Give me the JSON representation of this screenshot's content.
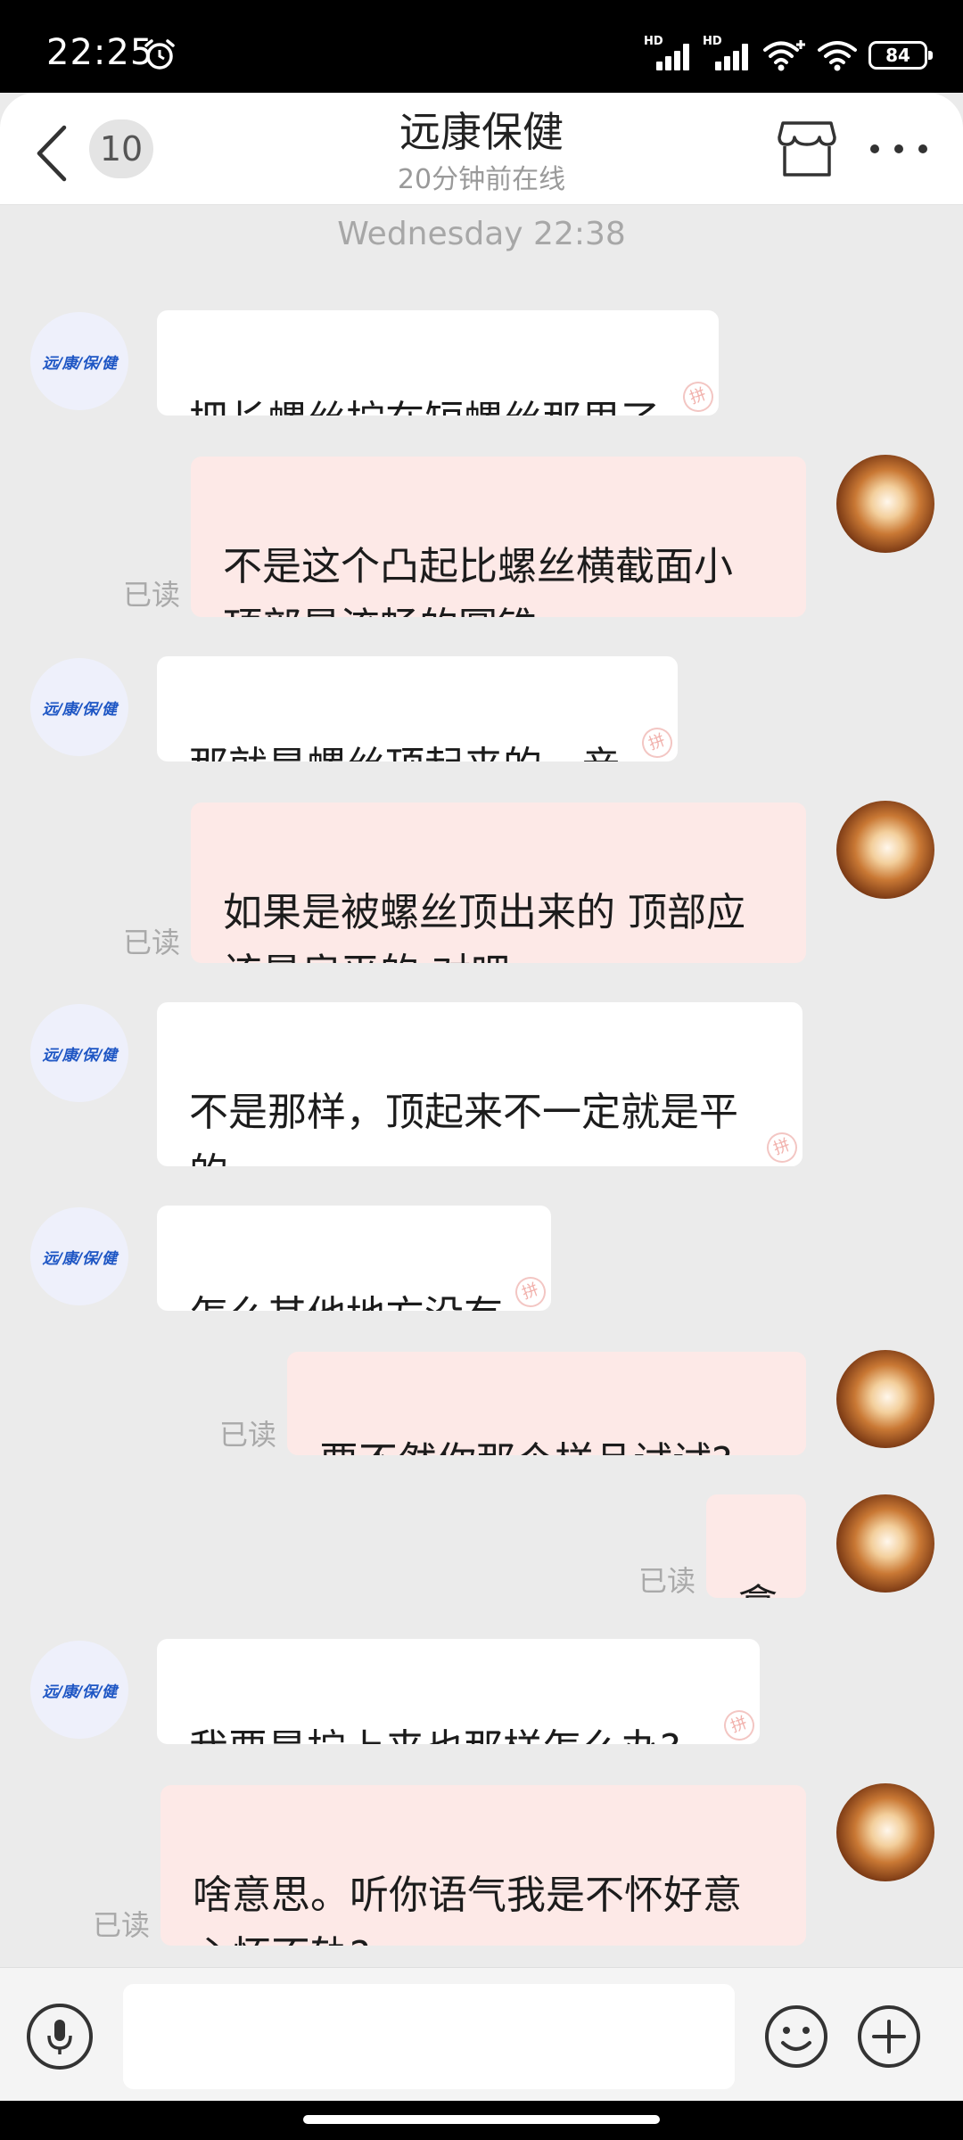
{
  "status_bar": {
    "time": "22:25",
    "signal_label_1": "HD",
    "signal_label_2": "HD",
    "battery": "84",
    "icons": [
      "alarm-icon",
      "signal-icon",
      "signal-icon",
      "wifi-icon",
      "wifi-icon",
      "battery-icon"
    ]
  },
  "header": {
    "title": "远康保健",
    "subtitle": "20分钟前在线",
    "unread_count": "10",
    "icons": [
      "back-icon",
      "shop-icon",
      "more-icon"
    ]
  },
  "conversation": {
    "time_divider": "Wednesday 22:38",
    "shop_avatar_text": "远/康/保/健",
    "messages": [
      {
        "side": "in",
        "text": "把长螺丝拧在短螺丝那里了"
      },
      {
        "side": "out",
        "text": "不是这个凸起比螺丝横截面小\n顶部是流畅的圆锥",
        "status": "已读"
      },
      {
        "side": "in",
        "text": "那就是螺丝顶起来的，亲"
      },
      {
        "side": "out",
        "text": "如果是被螺丝顶出来的 顶部应\n该是扁平的 对吧",
        "status": "已读"
      },
      {
        "side": "in",
        "text": "不是那样，顶起来不一定就是平\n的"
      },
      {
        "side": "in",
        "text": "怎么其他地方没有"
      },
      {
        "side": "out",
        "text": "要不然你那个样品试试?",
        "status": "已读"
      },
      {
        "side": "out",
        "text": "拿",
        "status": "已读"
      },
      {
        "side": "in",
        "text": "我要是拧上来也那样怎么办?"
      },
      {
        "side": "out",
        "text": "啥意思。听你语气我是不怀好意\n心怀不轨?",
        "status": "已读"
      }
    ]
  },
  "input_bar": {
    "placeholder": "",
    "icons": [
      "microphone-icon",
      "emoji-icon",
      "plus-icon"
    ]
  },
  "colors": {
    "chat_background": "#ebebeb",
    "incoming_bubble": "#ffffff",
    "outgoing_bubble": "#fde9e7",
    "shop_logo_blue": "#1e56c4"
  }
}
